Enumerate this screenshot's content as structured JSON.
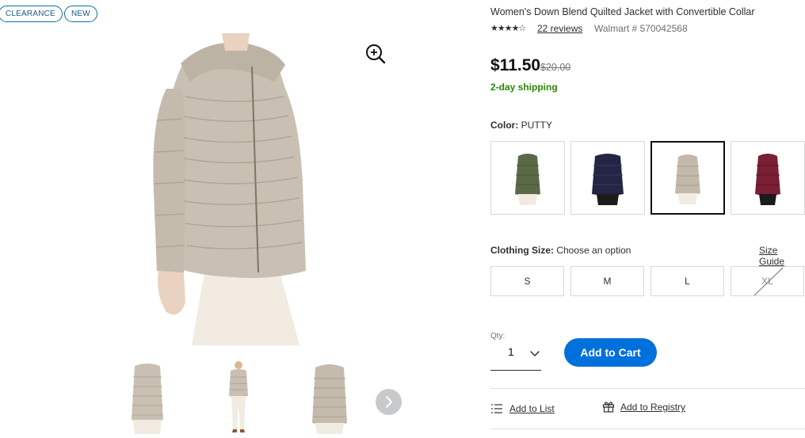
{
  "badges": {
    "clearance": "CLEARANCE",
    "new": "NEW"
  },
  "product": {
    "title": "Women's Down Blend Quilted Jacket with Convertible Collar",
    "stars": "★★★★☆",
    "reviews_label": "22 reviews",
    "item_number": "Walmart # 570042568",
    "price": "$11.50",
    "was_price": "$20.00",
    "shipping": "2-day shipping"
  },
  "color": {
    "label": "Color:",
    "selected": "PUTTY",
    "swatches": [
      {
        "name": "olive",
        "color": "#5b6a46"
      },
      {
        "name": "navy",
        "color": "#242444"
      },
      {
        "name": "putty",
        "color": "#c2b9ab"
      },
      {
        "name": "burgundy",
        "color": "#7a1f35"
      }
    ]
  },
  "size": {
    "label": "Clothing Size:",
    "prompt": "Choose an option",
    "guide": "Size Guide",
    "options": [
      "S",
      "M",
      "L",
      "XL"
    ],
    "unavailable": [
      "XL"
    ]
  },
  "qty": {
    "label": "Qty:",
    "value": "1"
  },
  "actions": {
    "add_to_cart": "Add to Cart",
    "add_to_list": "Add to List",
    "add_to_registry": "Add to Registry"
  },
  "colors": {
    "accent": "#0071dc",
    "shipping_green": "#2a8703",
    "badge_blue": "#0d6ea5"
  }
}
